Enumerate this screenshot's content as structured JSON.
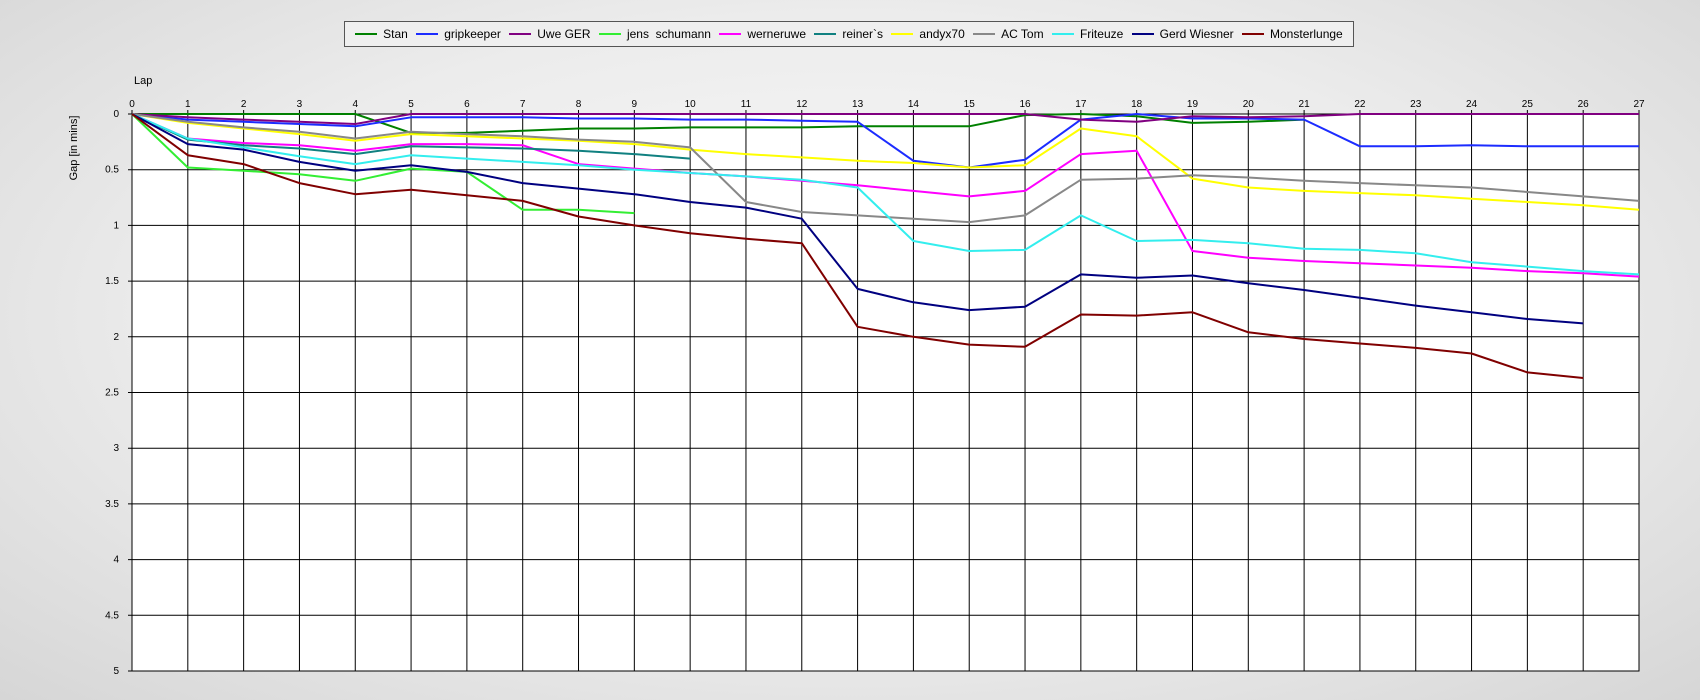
{
  "chart_data": {
    "type": "line",
    "xlabel": "Lap",
    "ylabel": "Gap [in mins]",
    "xlim": [
      0,
      27
    ],
    "ylim": [
      0,
      5
    ],
    "y_inverted": true,
    "x_ticks": [
      0,
      1,
      2,
      3,
      4,
      5,
      6,
      7,
      8,
      9,
      10,
      11,
      12,
      13,
      14,
      15,
      16,
      17,
      18,
      19,
      20,
      21,
      22,
      23,
      24,
      25,
      26,
      27
    ],
    "y_ticks": [
      0,
      0.5,
      1,
      1.5,
      2,
      2.5,
      3,
      3.5,
      4,
      4.5,
      5
    ],
    "y_tick_labels": [
      "0",
      "0.5",
      "1",
      "1.5",
      "2",
      "2.5",
      "3",
      "3.5",
      "4",
      "4.5",
      "5"
    ],
    "grid": true,
    "legend_position": "top-center",
    "series": [
      {
        "name": "Stan",
        "color": "#008000",
        "x": [
          0,
          1,
          2,
          3,
          4,
          5,
          6,
          7,
          8,
          9,
          10,
          11,
          12,
          13,
          14,
          15,
          16,
          17,
          18,
          19,
          20,
          21
        ],
        "values": [
          0,
          0,
          0,
          0,
          0,
          0.17,
          0.17,
          0.15,
          0.13,
          0.13,
          0.12,
          0.12,
          0.12,
          0.11,
          0.11,
          0.11,
          0.01,
          0.0,
          0.02,
          0.08,
          0.07,
          0.05
        ]
      },
      {
        "name": "gripkeeper",
        "color": "#1c2cff",
        "x": [
          0,
          1,
          2,
          3,
          4,
          5,
          6,
          7,
          8,
          9,
          10,
          11,
          12,
          13,
          14,
          15,
          16,
          17,
          18,
          19,
          20,
          21,
          22,
          23,
          24,
          25,
          26,
          27
        ],
        "values": [
          0,
          0.05,
          0.07,
          0.09,
          0.11,
          0.03,
          0.03,
          0.03,
          0.04,
          0.04,
          0.05,
          0.05,
          0.06,
          0.07,
          0.42,
          0.48,
          0.41,
          0.05,
          0.0,
          0.04,
          0.04,
          0.05,
          0.29,
          0.29,
          0.28,
          0.29,
          0.29,
          0.29
        ]
      },
      {
        "name": "Uwe GER",
        "color": "#800080",
        "x": [
          0,
          1,
          2,
          3,
          4,
          5,
          6,
          7,
          8,
          9,
          10,
          11,
          12,
          13,
          14,
          15,
          16,
          17,
          18,
          19,
          20,
          21,
          22,
          23,
          24,
          25,
          26,
          27
        ],
        "values": [
          0,
          0.03,
          0.05,
          0.07,
          0.09,
          0,
          0,
          0,
          0,
          0,
          0,
          0,
          0,
          0,
          0,
          0,
          0,
          0.05,
          0.07,
          0.02,
          0.03,
          0.02,
          0,
          0,
          0,
          0,
          0,
          0
        ]
      },
      {
        "name": "jens  schumann",
        "color": "#33ee33",
        "x": [
          0,
          1,
          2,
          3,
          4,
          5,
          6,
          7,
          8,
          9
        ],
        "values": [
          0,
          0.48,
          0.51,
          0.54,
          0.6,
          0.49,
          0.52,
          0.86,
          0.86,
          0.89
        ]
      },
      {
        "name": "werneruwe",
        "color": "#ff00ff",
        "x": [
          0,
          1,
          2,
          3,
          4,
          5,
          6,
          7,
          8,
          9,
          10,
          11,
          12,
          13,
          14,
          15,
          16,
          17,
          18,
          19,
          20,
          21,
          22,
          23,
          24,
          25,
          26,
          27
        ],
        "values": [
          0,
          0.22,
          0.26,
          0.28,
          0.33,
          0.27,
          0.27,
          0.28,
          0.45,
          0.49,
          0.53,
          0.56,
          0.6,
          0.64,
          0.69,
          0.74,
          0.69,
          0.36,
          0.33,
          1.23,
          1.29,
          1.32,
          1.34,
          1.36,
          1.38,
          1.41,
          1.43,
          1.46
        ]
      },
      {
        "name": "reiner`s",
        "color": "#108080",
        "x": [
          0,
          1,
          2,
          3,
          4,
          5,
          6,
          7,
          8,
          9,
          10
        ],
        "values": [
          0,
          0.23,
          0.28,
          0.31,
          0.36,
          0.29,
          0.3,
          0.31,
          0.33,
          0.36,
          0.4
        ]
      },
      {
        "name": "andyx70",
        "color": "#ffff00",
        "x": [
          0,
          1,
          2,
          3,
          4,
          5,
          6,
          7,
          8,
          9,
          10,
          11,
          12,
          13,
          14,
          15,
          16,
          17,
          18,
          19,
          20,
          21,
          22,
          23,
          24,
          25,
          26,
          27
        ],
        "values": [
          0,
          0.08,
          0.13,
          0.18,
          0.24,
          0.18,
          0.2,
          0.22,
          0.24,
          0.27,
          0.32,
          0.36,
          0.39,
          0.42,
          0.44,
          0.48,
          0.46,
          0.13,
          0.2,
          0.58,
          0.66,
          0.69,
          0.71,
          0.73,
          0.76,
          0.79,
          0.82,
          0.86
        ]
      },
      {
        "name": "AC Tom",
        "color": "#888888",
        "x": [
          0,
          1,
          2,
          3,
          4,
          5,
          6,
          7,
          8,
          9,
          10,
          11,
          12,
          13,
          14,
          15,
          16,
          17,
          18,
          19,
          20,
          21,
          22,
          23,
          24,
          25,
          26,
          27
        ],
        "values": [
          0,
          0.07,
          0.12,
          0.16,
          0.22,
          0.16,
          0.18,
          0.2,
          0.23,
          0.25,
          0.3,
          0.79,
          0.88,
          0.91,
          0.94,
          0.97,
          0.91,
          0.59,
          0.58,
          0.55,
          0.57,
          0.6,
          0.62,
          0.64,
          0.66,
          0.7,
          0.74,
          0.78
        ]
      },
      {
        "name": "Friteuze",
        "color": "#33eeee",
        "x": [
          0,
          1,
          2,
          3,
          4,
          5,
          6,
          7,
          8,
          9,
          10,
          11,
          12,
          13,
          14,
          15,
          16,
          17,
          18,
          19,
          20,
          21,
          22,
          23,
          24,
          25,
          26,
          27
        ],
        "values": [
          0,
          0.22,
          0.3,
          0.38,
          0.45,
          0.37,
          0.4,
          0.43,
          0.46,
          0.5,
          0.53,
          0.56,
          0.59,
          0.66,
          1.14,
          1.23,
          1.22,
          0.91,
          1.14,
          1.13,
          1.16,
          1.21,
          1.22,
          1.25,
          1.33,
          1.37,
          1.41,
          1.44
        ]
      },
      {
        "name": "Gerd Wiesner",
        "color": "#000080",
        "x": [
          0,
          1,
          2,
          3,
          4,
          5,
          6,
          7,
          8,
          9,
          10,
          11,
          12,
          13,
          14,
          15,
          16,
          17,
          18,
          19,
          20,
          21,
          22,
          23,
          24,
          25,
          26
        ],
        "values": [
          0,
          0.27,
          0.32,
          0.43,
          0.51,
          0.46,
          0.52,
          0.62,
          0.67,
          0.72,
          0.79,
          0.84,
          0.94,
          1.57,
          1.69,
          1.76,
          1.73,
          1.44,
          1.47,
          1.45,
          1.52,
          1.58,
          1.65,
          1.72,
          1.78,
          1.84,
          1.88
        ]
      },
      {
        "name": "Monsterlunge",
        "color": "#800000",
        "x": [
          0,
          1,
          2,
          3,
          4,
          5,
          6,
          7,
          8,
          9,
          10,
          11,
          12,
          13,
          14,
          15,
          16,
          17,
          18,
          19,
          20,
          21,
          22,
          23,
          24,
          25,
          26
        ],
        "values": [
          0,
          0.37,
          0.45,
          0.62,
          0.72,
          0.68,
          0.73,
          0.78,
          0.92,
          1.0,
          1.07,
          1.12,
          1.16,
          1.91,
          2.0,
          2.07,
          2.09,
          1.8,
          1.81,
          1.78,
          1.96,
          2.02,
          2.06,
          2.1,
          2.15,
          2.32,
          2.37
        ]
      }
    ]
  }
}
